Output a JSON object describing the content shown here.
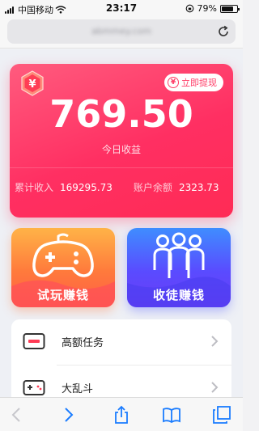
{
  "status_bar": {
    "carrier": "中国移动",
    "time": "23:17",
    "battery_percent_text": "79%",
    "battery_level": 0.79
  },
  "url_bar": {
    "url": "abmmey.com"
  },
  "earnings": {
    "today_amount": "769.50",
    "today_label": "今日收益",
    "withdraw_label": "立即提现",
    "withdraw_coin": "¥",
    "badge_symbol": "¥",
    "total_label": "累计收入",
    "total_value": "169295.73",
    "balance_label": "账户余额",
    "balance_value": "2323.73"
  },
  "tiles": [
    {
      "label": "试玩赚钱",
      "icon": "gamepad-icon"
    },
    {
      "label": "收徒赚钱",
      "icon": "people-group-icon"
    }
  ],
  "tasks": [
    {
      "label": "高额任务",
      "icon": "card-icon"
    },
    {
      "label": "大乱斗",
      "icon": "game-console-icon"
    }
  ],
  "colors": {
    "card_red": "#ff2f62",
    "trial_orange": "#ff7a3c",
    "recruit_purple": "#5a4bff",
    "ios_blue": "#1a7cff"
  },
  "toolbar": {
    "icons": [
      "back-icon",
      "forward-icon",
      "share-icon",
      "bookmarks-icon",
      "tabs-icon"
    ]
  }
}
